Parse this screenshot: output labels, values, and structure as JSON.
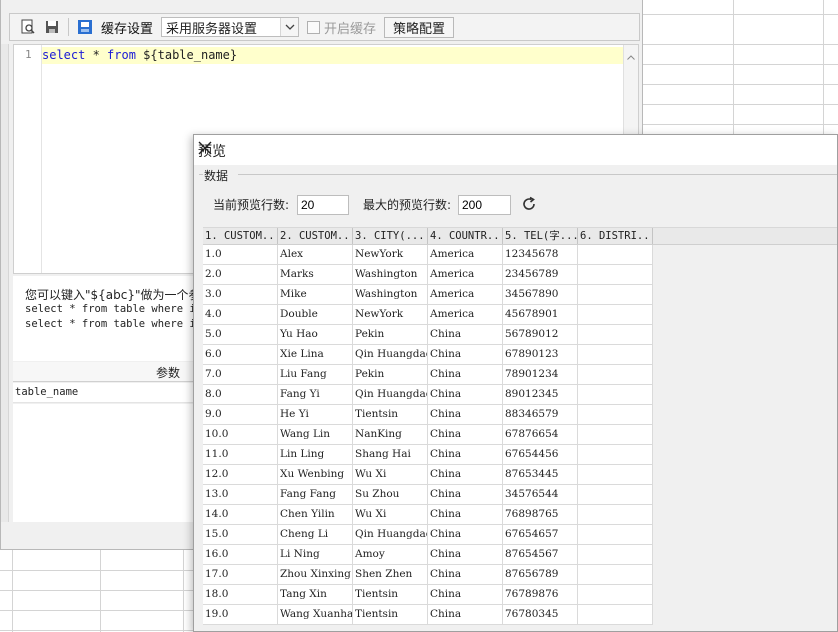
{
  "toolbar": {
    "cache_label": "缓存设置",
    "cache_mode_value": "采用服务器设置",
    "enable_cache_label": "开启缓存",
    "strategy_button": "策略配置"
  },
  "editor": {
    "line_number": "1",
    "sql": {
      "kw1": "select",
      "star": " * ",
      "kw2": "from",
      "rest": " ${table_name}"
    }
  },
  "hint": {
    "title": "您可以键入\"${abc}\"做为一个参数",
    "lines": [
      "select * from table where id",
      "select * from table where id"
    ]
  },
  "params": {
    "header": "参数",
    "rows": [
      "table_name"
    ]
  },
  "dialog": {
    "title": "预览",
    "group_label": "数据",
    "current_rows_label": "当前预览行数:",
    "current_rows_value": "20",
    "max_rows_label": "最大的预览行数:",
    "max_rows_value": "200",
    "columns": [
      "1. CUSTOM...",
      "2. CUSTOM...",
      "3. CITY(...",
      "4. COUNTR...",
      "5. TEL(字...",
      "6. DISTRI..."
    ],
    "rows": [
      [
        "1.0",
        "Alex",
        "NewYork",
        "America",
        "12345678",
        ""
      ],
      [
        "2.0",
        "Marks",
        "Washington",
        "America",
        "23456789",
        ""
      ],
      [
        "3.0",
        "Mike",
        "Washington",
        "America",
        "34567890",
        ""
      ],
      [
        "4.0",
        "Double",
        "NewYork",
        "America",
        "45678901",
        ""
      ],
      [
        "5.0",
        "Yu Hao",
        "Pekin",
        "China",
        "56789012",
        ""
      ],
      [
        "6.0",
        "Xie Lina",
        "Qin Huangdao",
        "China",
        "67890123",
        ""
      ],
      [
        "7.0",
        "Liu Fang",
        "Pekin",
        "China",
        "78901234",
        ""
      ],
      [
        "8.0",
        "Fang Yi",
        "Qin Huangdao",
        "China",
        "89012345",
        ""
      ],
      [
        "9.0",
        "He Yi",
        "Tientsin",
        "China",
        "88346579",
        ""
      ],
      [
        "10.0",
        "Wang Lin",
        "NanKing",
        "China",
        "67876654",
        ""
      ],
      [
        "11.0",
        "Lin Ling",
        "Shang Hai",
        "China",
        "67654456",
        ""
      ],
      [
        "12.0",
        "Xu Wenbing",
        "Wu Xi",
        "China",
        "87653445",
        ""
      ],
      [
        "13.0",
        "Fang Fang",
        "Su Zhou",
        "China",
        "34576544",
        ""
      ],
      [
        "14.0",
        "Chen Yilin",
        "Wu Xi",
        "China",
        "76898765",
        ""
      ],
      [
        "15.0",
        "Cheng Li",
        "Qin Huangdao",
        "China",
        "67654657",
        ""
      ],
      [
        "16.0",
        "Li Ning",
        "Amoy",
        "China",
        "87654567",
        ""
      ],
      [
        "17.0",
        "Zhou Xinxing",
        "Shen Zhen",
        "China",
        "87656789",
        ""
      ],
      [
        "18.0",
        "Tang Xin",
        "Tientsin",
        "China",
        "76789876",
        ""
      ],
      [
        "19.0",
        "Wang Xuanhao",
        "Tientsin",
        "China",
        "76780345",
        ""
      ]
    ]
  }
}
